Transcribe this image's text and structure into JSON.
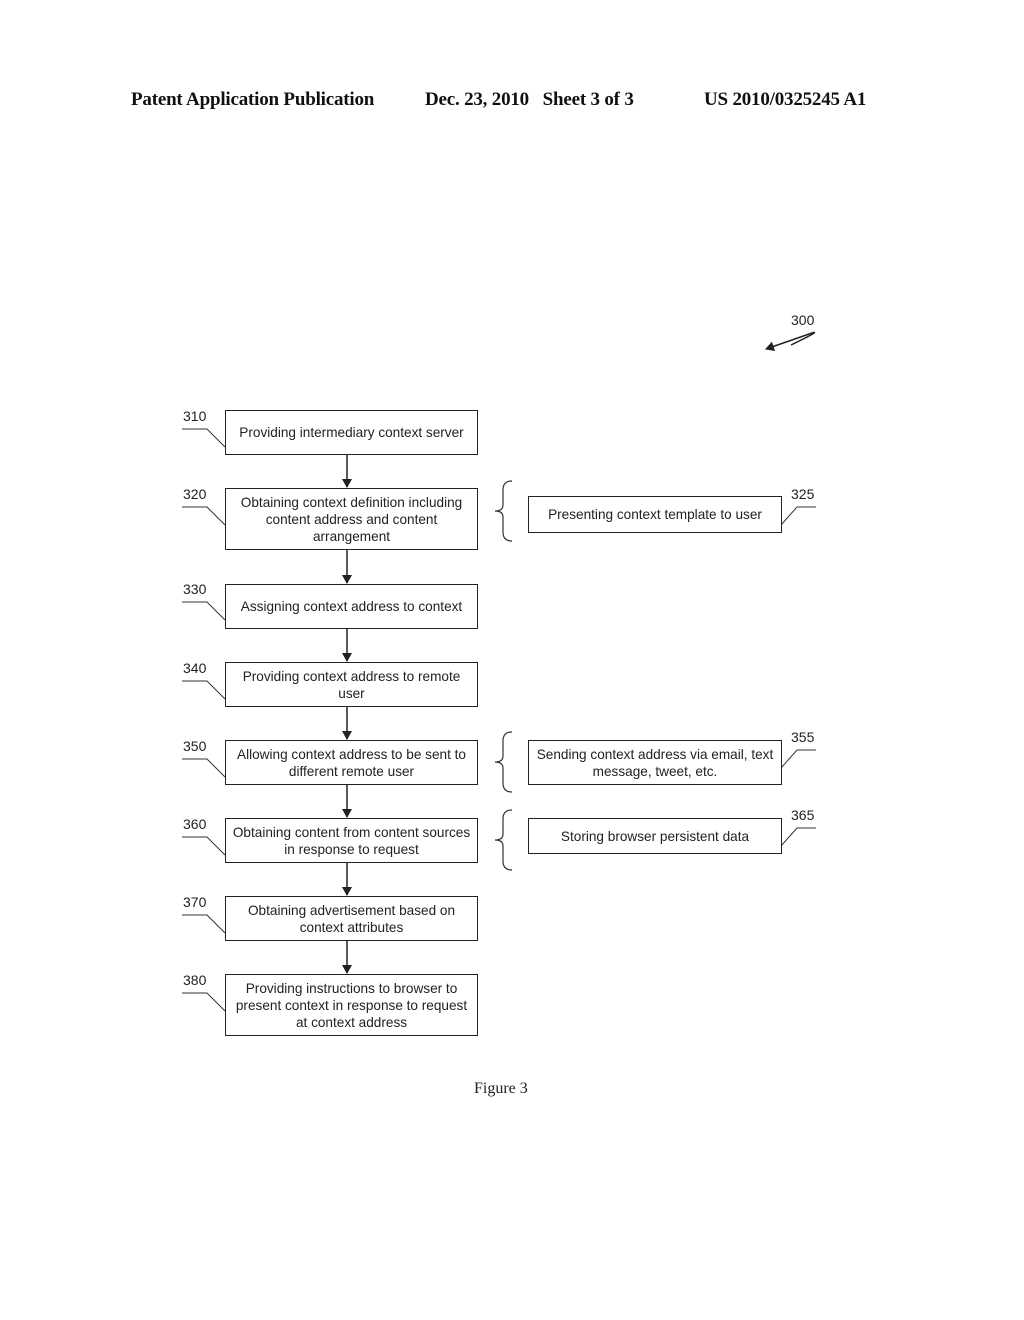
{
  "header": {
    "publication": "Patent Application Publication",
    "date_sheet": "Dec. 23, 2010   Sheet 3 of 3",
    "patent_number": "US 2010/0325245 A1"
  },
  "figure": {
    "reference": "300",
    "caption": "Figure 3"
  },
  "steps": [
    {
      "id": "310",
      "text": "Providing intermediary context server"
    },
    {
      "id": "320",
      "text": "Obtaining context definition including content address and content arrangement"
    },
    {
      "id": "330",
      "text": "Assigning context address to context"
    },
    {
      "id": "340",
      "text": "Providing context address to remote user"
    },
    {
      "id": "350",
      "text": "Allowing context address to be sent to different remote user"
    },
    {
      "id": "360",
      "text": "Obtaining content from content sources in response to request"
    },
    {
      "id": "370",
      "text": "Obtaining advertisement based on context attributes"
    },
    {
      "id": "380",
      "text": "Providing instructions to browser to present context in response to request at context address"
    }
  ],
  "sub_steps": [
    {
      "id": "325",
      "parent": "320",
      "text": "Presenting context template to user"
    },
    {
      "id": "355",
      "parent": "350",
      "text": "Sending context address via email, text message, tweet, etc."
    },
    {
      "id": "365",
      "parent": "360",
      "text": "Storing browser persistent data"
    }
  ]
}
